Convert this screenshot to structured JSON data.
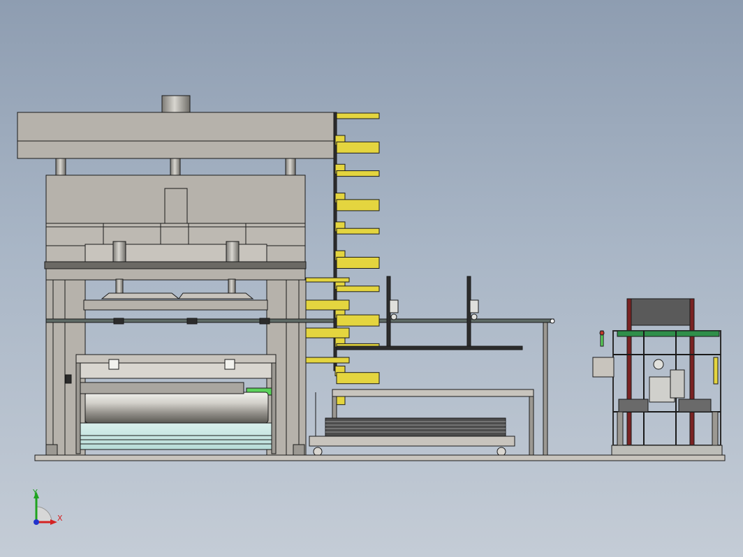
{
  "viewport": {
    "background_top": "#8e9db1",
    "background_bottom": "#c4ccd6"
  },
  "triad": {
    "x_label": "X",
    "y_label": "Y",
    "x_color": "#d42222",
    "y_color": "#1fa31f",
    "z_color": "#2233cc"
  },
  "colors": {
    "press_body": "#b6b2ab",
    "edge": "#1a1a1a",
    "rack_yellow": "#e4d53f",
    "steel": "#2c2c2c",
    "cell_frame_red": "#7a2323",
    "guard_green": "#2f8f4a"
  }
}
